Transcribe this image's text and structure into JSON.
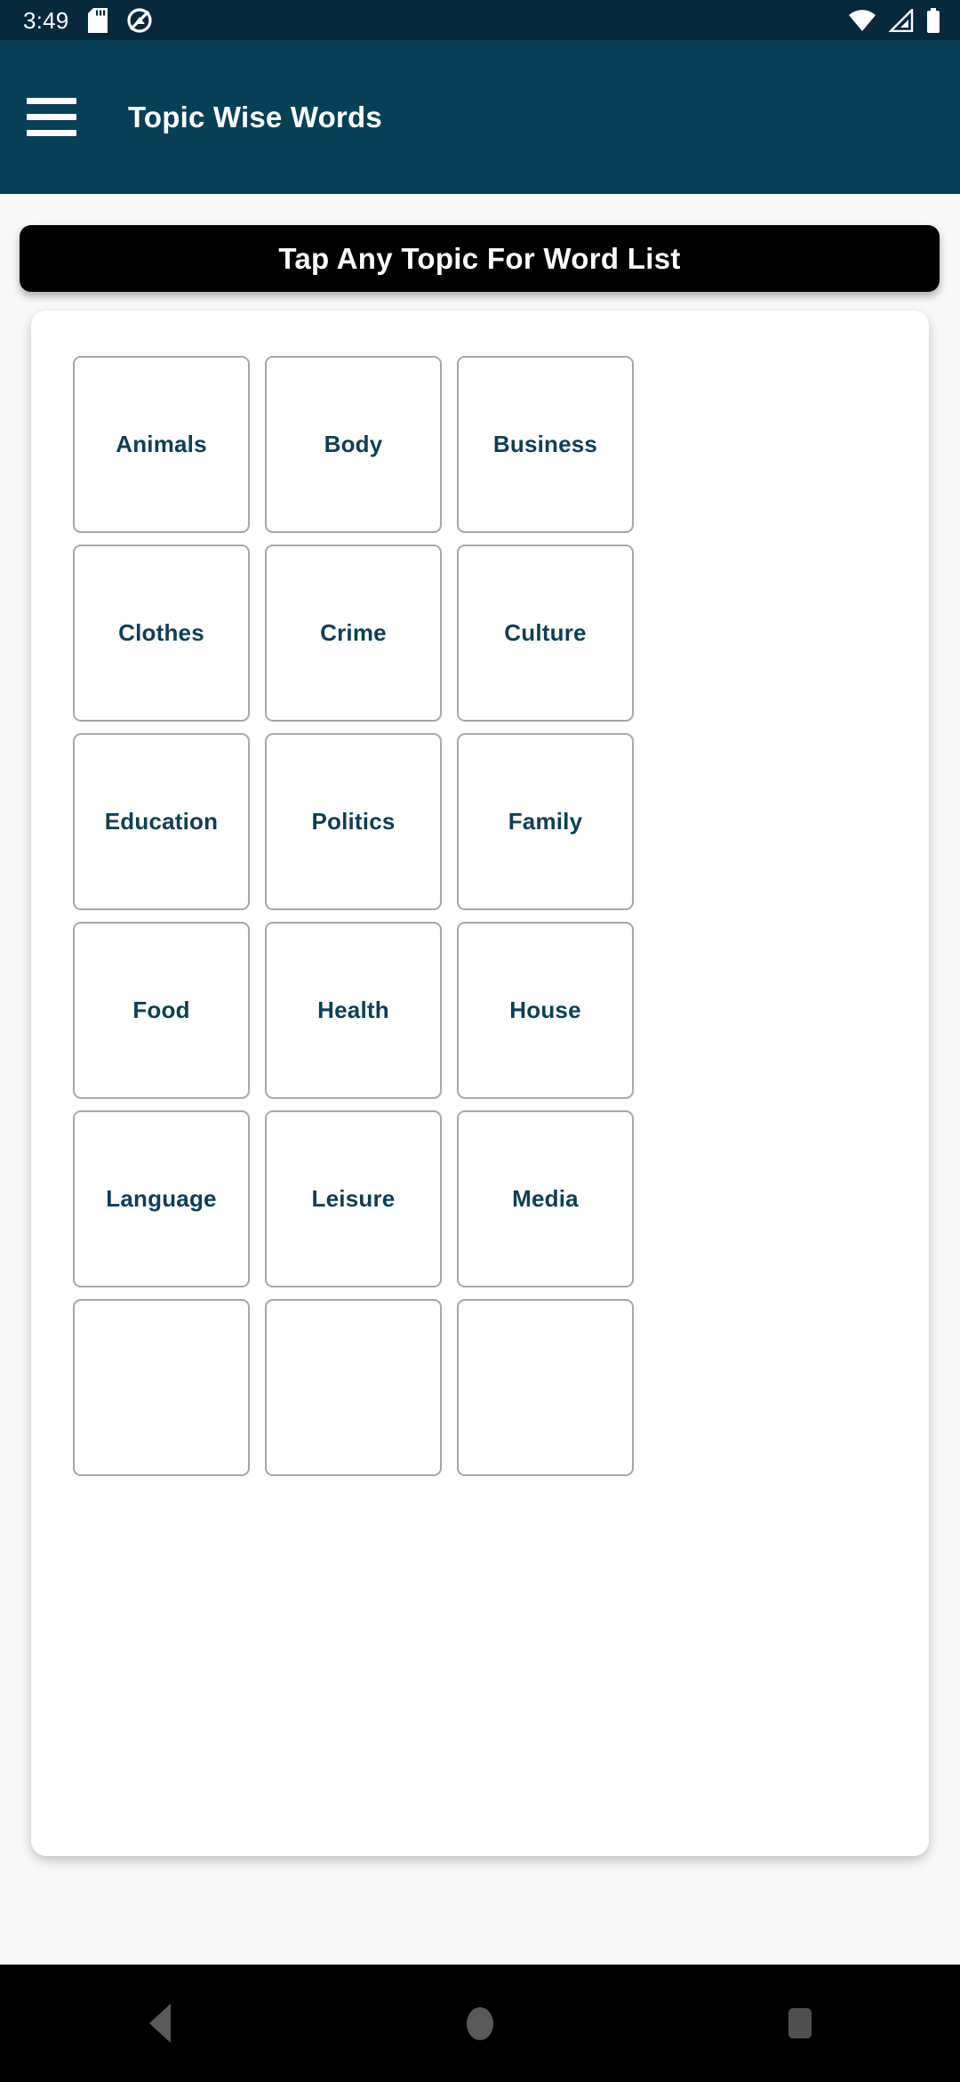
{
  "status_bar": {
    "time": "3:49",
    "left_icons": [
      "sd-card-icon",
      "quick-app-icon"
    ],
    "right_icons": [
      "wifi-icon",
      "cell-signal-icon",
      "battery-icon"
    ],
    "background_color": "#06293c"
  },
  "app_bar": {
    "menu_icon": "hamburger-menu-icon",
    "title": "Topic Wise Words",
    "background_color": "#074056",
    "text_color": "#ffffff"
  },
  "banner": {
    "text": "Tap Any Topic For Word List",
    "background_color": "#000000",
    "text_color": "#ffffff"
  },
  "topics": {
    "accent_color": "#0d3f57",
    "border_color": "#a8a8a8",
    "items": [
      {
        "label": "Animals"
      },
      {
        "label": "Body"
      },
      {
        "label": "Business"
      },
      {
        "label": "Clothes"
      },
      {
        "label": "Crime"
      },
      {
        "label": "Culture"
      },
      {
        "label": "Education"
      },
      {
        "label": "Politics"
      },
      {
        "label": "Family"
      },
      {
        "label": "Food"
      },
      {
        "label": "Health"
      },
      {
        "label": "House"
      },
      {
        "label": "Language"
      },
      {
        "label": "Leisure"
      },
      {
        "label": "Media"
      },
      {
        "label": ""
      },
      {
        "label": ""
      },
      {
        "label": ""
      }
    ]
  },
  "nav_bar": {
    "background_color": "#000000",
    "buttons": [
      {
        "name": "back",
        "icon": "triangle-left-icon"
      },
      {
        "name": "home",
        "icon": "circle-icon"
      },
      {
        "name": "recents",
        "icon": "square-icon"
      }
    ]
  }
}
